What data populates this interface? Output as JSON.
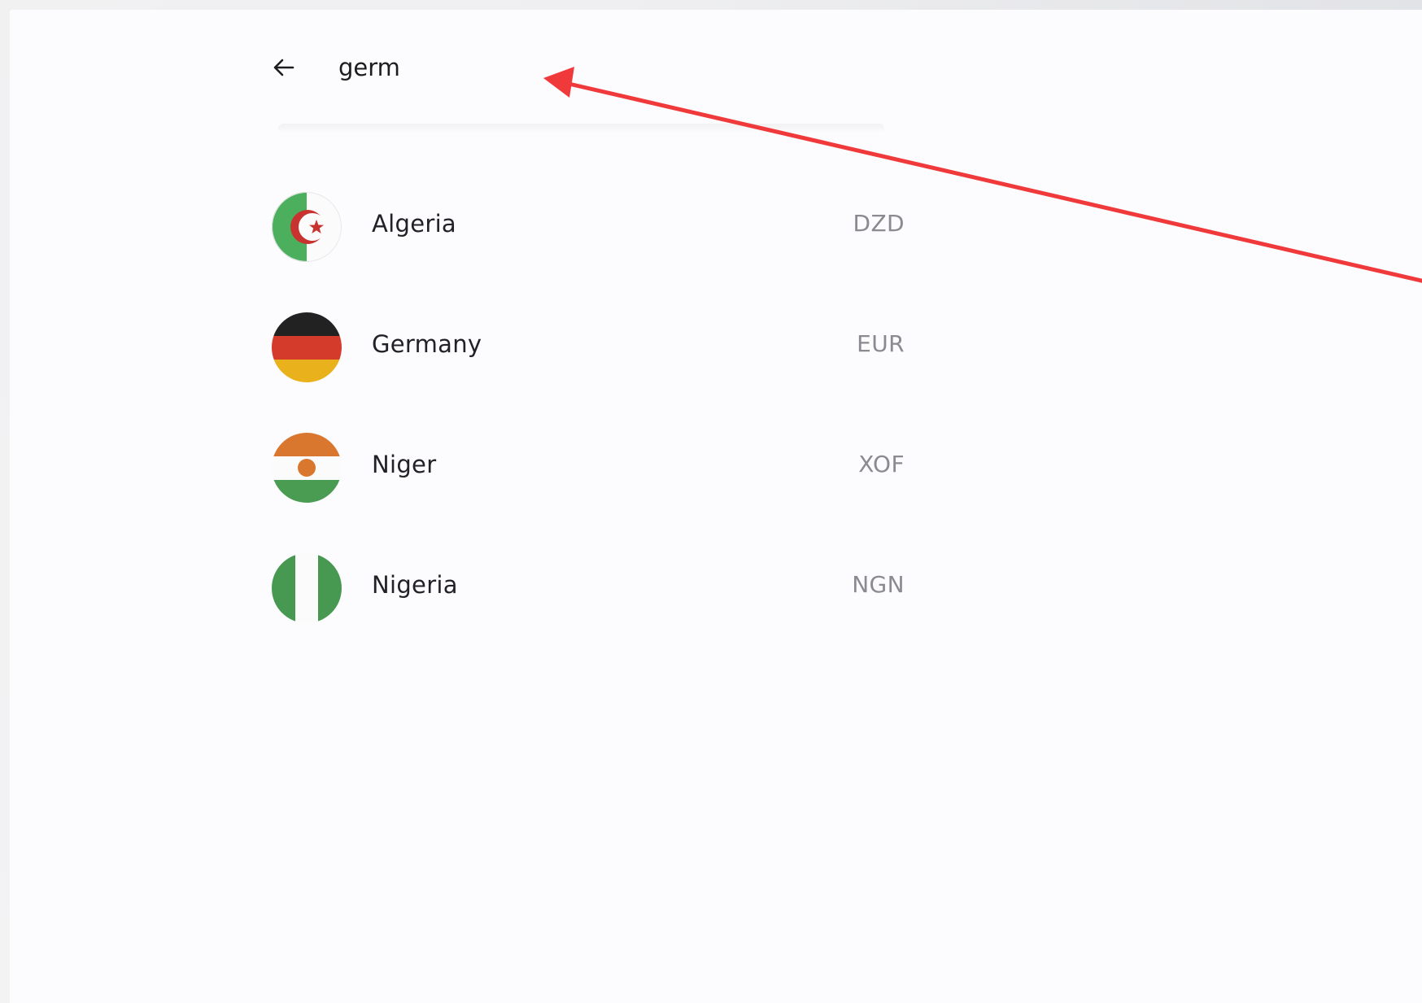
{
  "search": {
    "query": "germ"
  },
  "results": [
    {
      "country": "Algeria",
      "currency": "DZD",
      "flag": "algeria-flag-icon"
    },
    {
      "country": "Germany",
      "currency": "EUR",
      "flag": "germany-flag-icon"
    },
    {
      "country": "Niger",
      "currency": "XOF",
      "flag": "niger-flag-icon"
    },
    {
      "country": "Nigeria",
      "currency": "NGN",
      "flag": "nigeria-flag-icon"
    }
  ],
  "colors": {
    "background": "#fcfbfd",
    "annotation_arrow": "#f0393a",
    "currency_text": "#8a8a90"
  },
  "icons": {
    "back": "arrow-left-icon"
  }
}
